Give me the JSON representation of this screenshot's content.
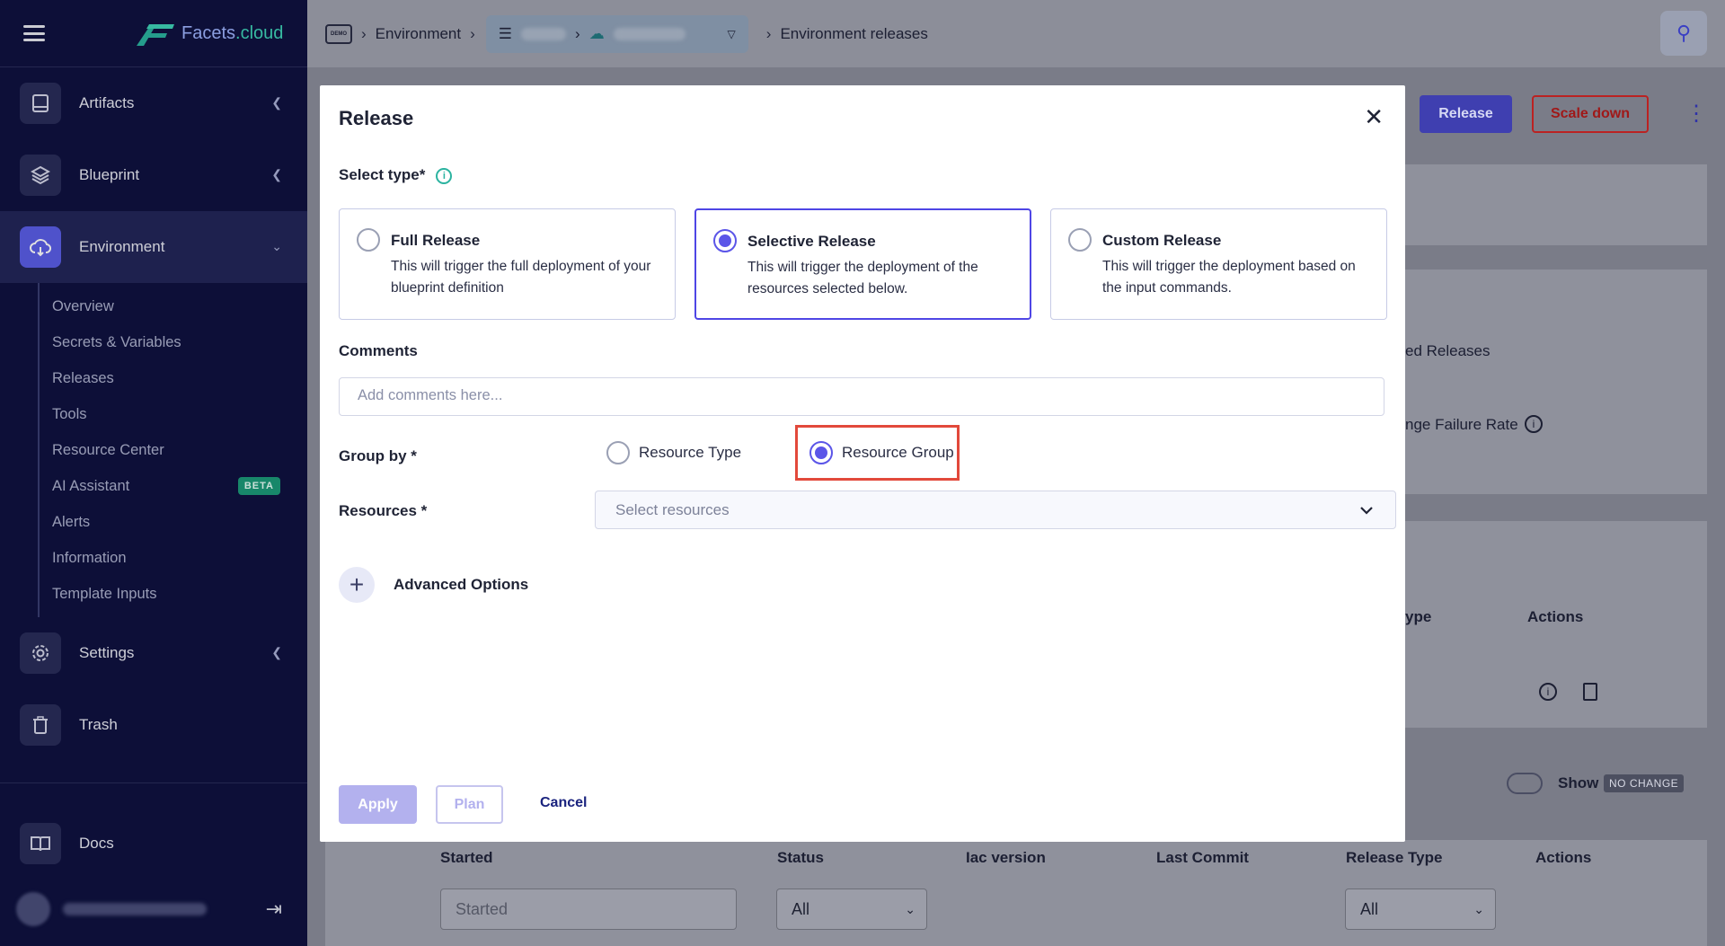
{
  "brand": {
    "name_part1": "Facets",
    "name_part2": ".cloud"
  },
  "sidebar": {
    "items": [
      {
        "label": "Artifacts",
        "icon": "book-icon"
      },
      {
        "label": "Blueprint",
        "icon": "layers-icon"
      },
      {
        "label": "Environment",
        "icon": "cloud-upload-icon"
      },
      {
        "label": "Settings",
        "icon": "gear-icon"
      },
      {
        "label": "Trash",
        "icon": "trash-icon"
      }
    ],
    "env_sub": [
      "Overview",
      "Secrets & Variables",
      "Releases",
      "Tools",
      "Resource Center",
      "AI Assistant",
      "Alerts",
      "Information",
      "Template Inputs"
    ],
    "beta_label": "BETA",
    "docs_label": "Docs"
  },
  "topbar": {
    "crumb_icon_text": "DEMO",
    "crumb_environment": "Environment",
    "crumb_current": "Environment releases"
  },
  "background": {
    "release_label": "Release",
    "scale_down_label": "Scale down",
    "partial_releases": "ed Releases",
    "partial_failure": "nge Failure Rate",
    "partial_type": "ype",
    "actions_upper": "Actions",
    "show_label": "Show",
    "no_change": "NO CHANGE",
    "columns": [
      "Started",
      "Status",
      "Iac version",
      "Last Commit",
      "Release Type",
      "Actions"
    ],
    "started_placeholder": "Started",
    "status_value": "All",
    "release_type_value": "All"
  },
  "modal": {
    "title": "Release",
    "select_type_label": "Select type*",
    "types": [
      {
        "title": "Full Release",
        "desc": "This will trigger the full deployment of your blueprint definition",
        "selected": false
      },
      {
        "title": "Selective Release",
        "desc": "This will trigger the deployment of the resources selected below.",
        "selected": true
      },
      {
        "title": "Custom Release",
        "desc": "This will trigger the deployment based on the input commands.",
        "selected": false
      }
    ],
    "comments_label": "Comments",
    "comments_placeholder": "Add comments here...",
    "group_by_label": "Group by *",
    "group_by_options": [
      {
        "label": "Resource Type",
        "selected": false
      },
      {
        "label": "Resource Group",
        "selected": true
      }
    ],
    "resources_label": "Resources *",
    "resources_placeholder": "Select resources",
    "advanced_label": "Advanced Options",
    "apply_label": "Apply",
    "plan_label": "Plan",
    "cancel_label": "Cancel"
  },
  "colors": {
    "accent": "#4f46e5",
    "sidebar_bg": "#0f1240",
    "highlight": "#e2493b",
    "beta": "#1c9a79"
  }
}
